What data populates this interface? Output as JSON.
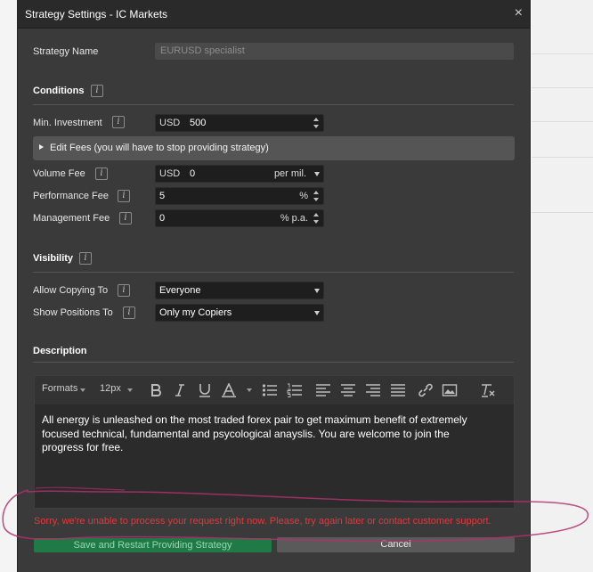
{
  "dialog": {
    "title": "Strategy Settings - IC Markets",
    "close_label": "×"
  },
  "strategy_name": {
    "label": "Strategy Name",
    "value": "EURUSD specialist"
  },
  "conditions": {
    "title": "Conditions",
    "min_investment": {
      "label": "Min. Investment",
      "currency": "USD",
      "value": "500"
    },
    "edit_fees": "Edit Fees (you will have to stop providing strategy)",
    "volume_fee": {
      "label": "Volume Fee",
      "currency": "USD",
      "value": "0",
      "unit": "per mil."
    },
    "performance_fee": {
      "label": "Performance Fee",
      "value": "5",
      "unit": "%"
    },
    "management_fee": {
      "label": "Management Fee",
      "value": "0",
      "unit": "% p.a."
    }
  },
  "visibility": {
    "title": "Visibility",
    "allow_copying": {
      "label": "Allow Copying To",
      "value": "Everyone"
    },
    "show_positions": {
      "label": "Show Positions To",
      "value": "Only my Copiers"
    }
  },
  "description": {
    "title": "Description",
    "toolbar": {
      "formats": "Formats",
      "font_size": "12px"
    },
    "text": "All energy is unleashed on the most traded forex pair to get maximum benefit of extremely focused technical, fundamental and psycological anayslis. You are welcome to join the progress for free."
  },
  "error_message": "Sorry, we're unable to process your request right now. Please, try again later or contact customer support.",
  "buttons": {
    "save": "Save and Restart Providing Strategy",
    "cancel": "Cancel"
  },
  "info_glyph": "i",
  "colors": {
    "dialog_bg": "#3a3a3a",
    "input_bg": "#1e1e1e",
    "error": "#e0393c",
    "save_button": "#1f7a45",
    "annotation_stroke": "#b0306e"
  },
  "icons": [
    "close-icon",
    "info-icon",
    "bold-icon",
    "italic-icon",
    "underline-icon",
    "font-color-icon",
    "bullet-list-icon",
    "numbered-list-icon",
    "align-left-icon",
    "align-center-icon",
    "align-right-icon",
    "justify-icon",
    "link-icon",
    "image-icon",
    "clear-format-icon"
  ]
}
